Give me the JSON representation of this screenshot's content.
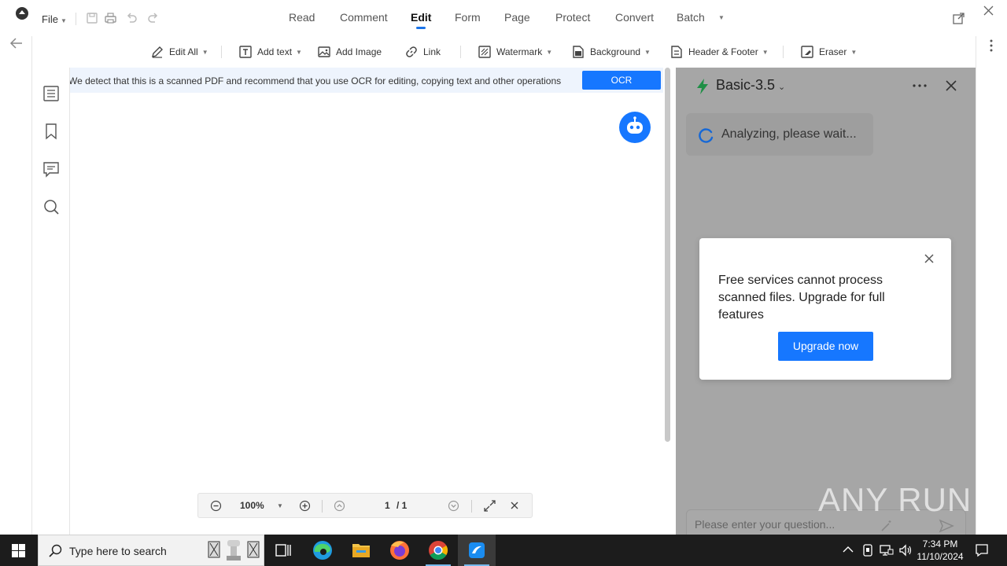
{
  "menu": {
    "file_label": "File",
    "tabs": [
      {
        "label": "Read"
      },
      {
        "label": "Comment"
      },
      {
        "label": "Edit",
        "active": true
      },
      {
        "label": "Form"
      },
      {
        "label": "Page"
      },
      {
        "label": "Protect"
      },
      {
        "label": "Convert"
      },
      {
        "label": "Batch"
      }
    ]
  },
  "toolbar": {
    "edit_all": "Edit All",
    "add_text": "Add text",
    "add_image": "Add Image",
    "link": "Link",
    "watermark": "Watermark",
    "background": "Background",
    "header_footer": "Header & Footer",
    "eraser": "Eraser"
  },
  "ocr": {
    "message": "We detect that this is a scanned PDF and recommend that you use OCR for editing, copying text and other operations",
    "button_label": "OCR"
  },
  "zoom": {
    "level": "100%",
    "page_current": "1",
    "page_total": "/ 1"
  },
  "ai_panel": {
    "model": "Basic-3.5",
    "status": "Analyzing, please wait...",
    "input_placeholder": "Please enter your question..."
  },
  "dialog": {
    "message": "Free services cannot process scanned files. Upgrade for full features",
    "button_label": "Upgrade now"
  },
  "watermark_text": "ANY RUN",
  "taskbar": {
    "search_placeholder": "Type here to search",
    "time": "7:34 PM",
    "date": "11/10/2024"
  },
  "colors": {
    "accent": "#1677ff",
    "panel_overlay": "#a6a6a6",
    "taskbar": "#1c1c1c"
  }
}
